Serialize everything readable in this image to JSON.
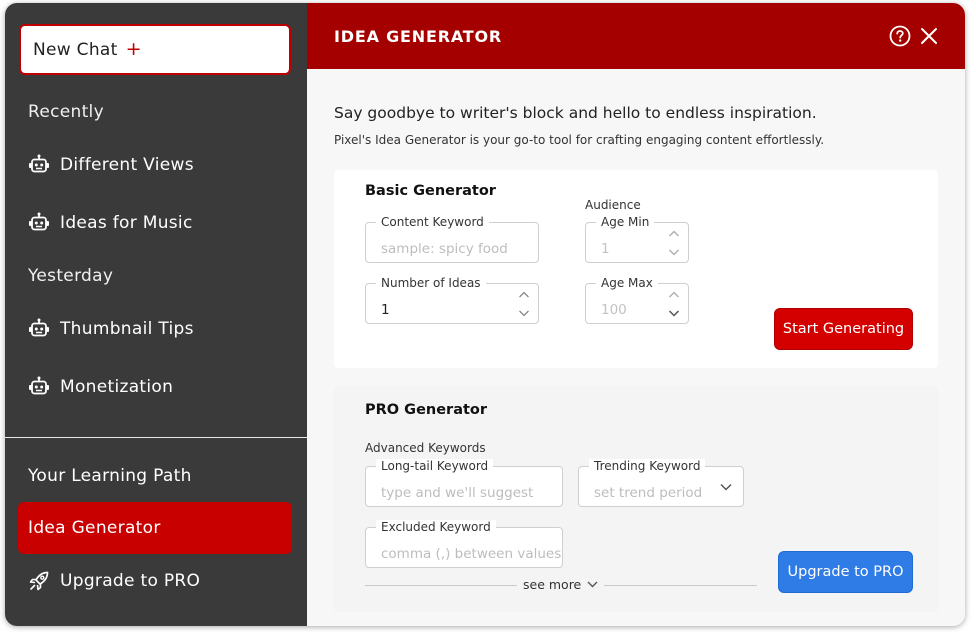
{
  "sidebar": {
    "new_chat_label": "New Chat",
    "new_chat_plus": "+",
    "sections": [
      {
        "label": "Recently",
        "items": [
          "Different Views",
          "Ideas for Music"
        ]
      },
      {
        "label": "Yesterday",
        "items": [
          "Thumbnail Tips",
          "Monetization"
        ]
      }
    ],
    "nav": {
      "learning_path": "Your Learning Path",
      "idea_generator": "Idea Generator",
      "upgrade": "Upgrade to PRO"
    }
  },
  "header": {
    "title": "IDEA GENERATOR"
  },
  "intro": {
    "headline": "Say goodbye to writer's block and hello to endless inspiration.",
    "subtext": "Pixel's Idea Generator is your go-to tool for crafting engaging content effortlessly."
  },
  "basic": {
    "title": "Basic Generator",
    "content_keyword": {
      "label": "Content Keyword",
      "placeholder": "sample: spicy food"
    },
    "number_of_ideas": {
      "label": "Number of Ideas",
      "value": "1"
    },
    "audience_label": "Audience",
    "age_min": {
      "label": "Age Min",
      "value": "1"
    },
    "age_max": {
      "label": "Age Max",
      "value": "100"
    },
    "button": "Start Generating"
  },
  "pro": {
    "title": "PRO Generator",
    "advanced_label": "Advanced Keywords",
    "long_tail": {
      "label": "Long-tail Keyword",
      "placeholder": "type and we'll suggest"
    },
    "trending": {
      "label": "Trending Keyword",
      "placeholder": "set trend period"
    },
    "excluded": {
      "label": "Excluded Keyword",
      "placeholder": "comma (,) between values"
    },
    "see_more": "see more",
    "button": "Upgrade to PRO"
  },
  "colors": {
    "header": "#a50000",
    "sidebar": "#3a3a3a",
    "accent_red": "#d40000",
    "accent_blue": "#2f7ce6"
  }
}
